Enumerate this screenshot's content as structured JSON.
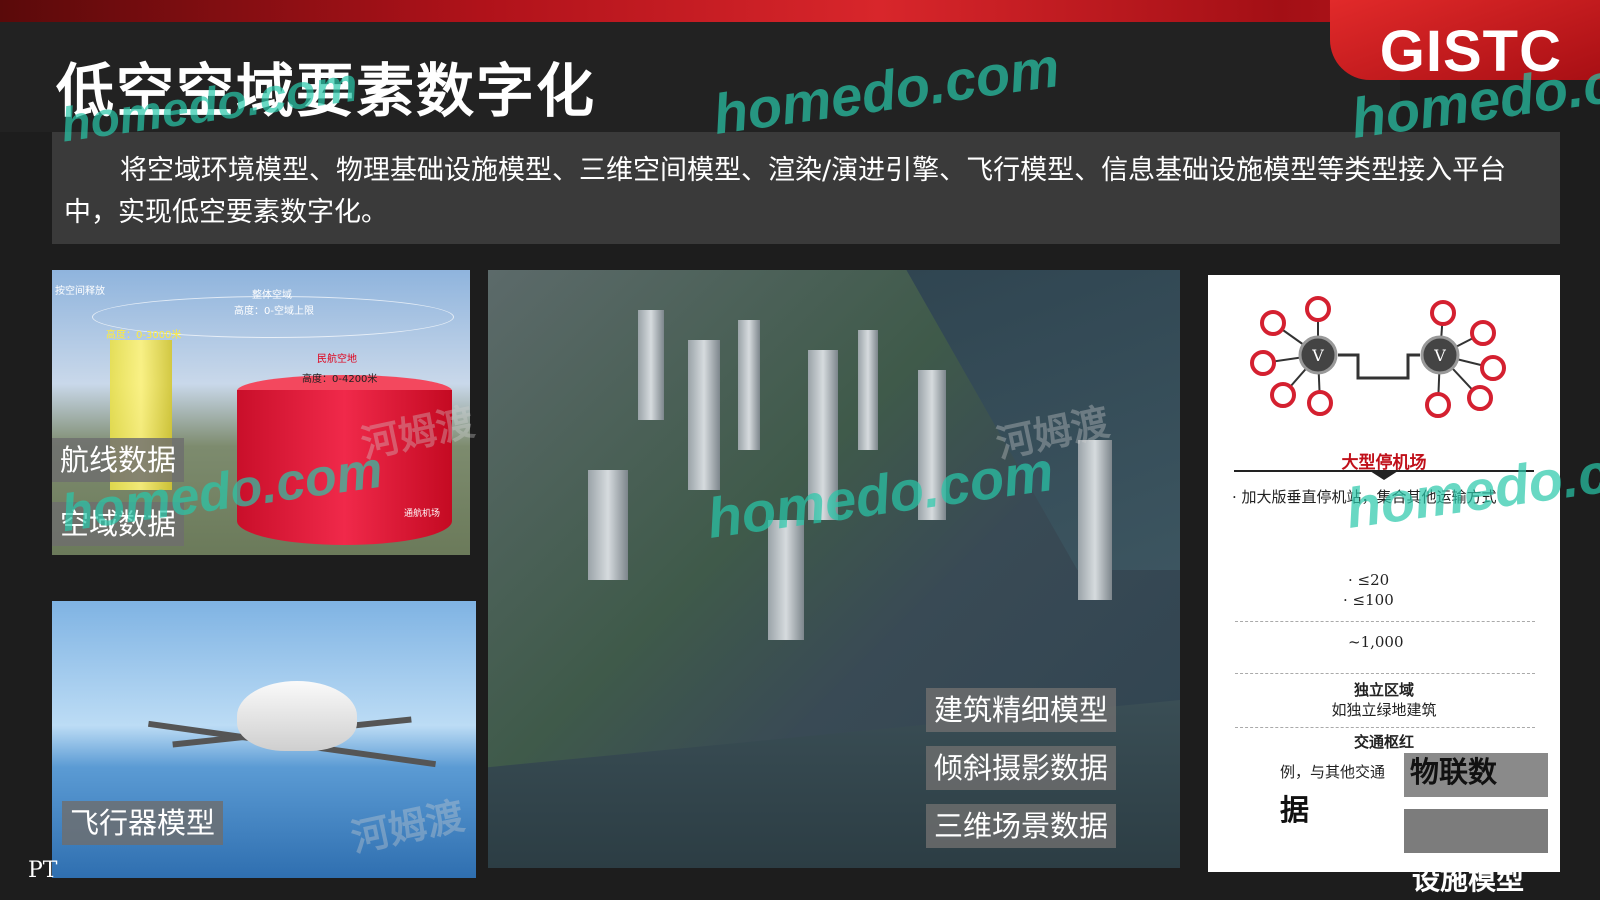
{
  "header": {
    "title": "低空空域要素数字化",
    "logo": "GISTC"
  },
  "intro": "将空域环境模型、物理基础设施模型、三维空间模型、渲染/演进引擎、飞行模型、信息基础设施模型等类型接入平台中，实现低空要素数字化。",
  "airspace_panel": {
    "labels": [
      "航线数据",
      "空域数据"
    ],
    "small_text": {
      "corner": "按空间释放",
      "top": "整体空域",
      "top_sub": "高度：0-空域上限",
      "yellow": "高度：0-3000米",
      "red": "民航空地",
      "red_sub": "高度：0-4200米",
      "airport": "通航机场"
    }
  },
  "aircraft_panel": {
    "label": "飞行器模型"
  },
  "city_panel": {
    "labels": [
      "建筑精细模型",
      "倾斜摄影数据",
      "三维场景数据"
    ]
  },
  "card": {
    "title": "大型停机场",
    "bullet": "加大版垂直停机站，集合其他运输方式",
    "values": [
      "≤20",
      "≤100",
      "~1,000"
    ],
    "zone_title": "独立区域",
    "zone_desc": "如独立绿地建筑",
    "hub_title": "交通枢红",
    "hub_desc": "例，与其他交通",
    "side_label_1": "物联数",
    "side_label_2": "据",
    "bottom_label": "设施模型"
  },
  "watermark": {
    "latin": "homedo.com",
    "cn": "河姆渡"
  },
  "footer": {
    "page_mark": "PT"
  },
  "colors": {
    "accent": "#c8161d",
    "background": "#1d1d1d",
    "panel": "#3a3a3a"
  }
}
